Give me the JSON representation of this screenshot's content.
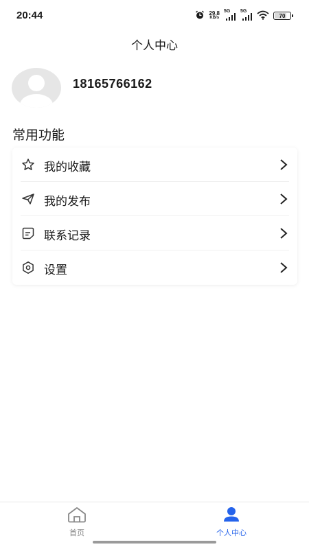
{
  "status_bar": {
    "time": "20:44",
    "net_speed_value": "29.8",
    "net_speed_unit": "KB/s",
    "signal1_label": "5G",
    "signal2_label": "5G",
    "battery": "70",
    "battery_level": 0.7,
    "icons": [
      "alarm-icon",
      "signal-icon",
      "signal-icon",
      "wifi-icon",
      "battery-icon"
    ]
  },
  "header": {
    "title": "个人中心"
  },
  "profile": {
    "phone": "18165766162",
    "avatar_icon": "default-avatar-icon"
  },
  "section": {
    "title": "常用功能"
  },
  "menu": {
    "items": [
      {
        "label": "我的收藏",
        "icon": "star-icon"
      },
      {
        "label": "我的发布",
        "icon": "send-icon"
      },
      {
        "label": "联系记录",
        "icon": "note-icon"
      },
      {
        "label": "设置",
        "icon": "settings-icon"
      }
    ]
  },
  "bottom_nav": {
    "tabs": [
      {
        "label": "首页",
        "icon": "home-icon",
        "active": false
      },
      {
        "label": "个人中心",
        "icon": "user-icon",
        "active": true
      }
    ],
    "active_color": "#2563eb",
    "inactive_color": "#888888"
  }
}
